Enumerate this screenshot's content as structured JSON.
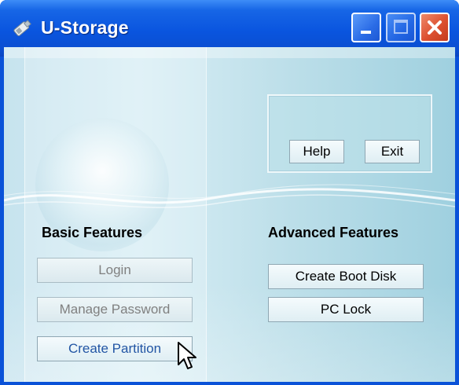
{
  "window": {
    "title": "U-Storage",
    "controls": {
      "minimize": "minimize",
      "maximize": "maximize",
      "close": "close"
    }
  },
  "basic": {
    "heading": "Basic Features",
    "buttons": [
      {
        "label": "Login",
        "state": "disabled"
      },
      {
        "label": "Manage Password",
        "state": "disabled"
      },
      {
        "label": "Create Partition",
        "state": "enabled"
      }
    ]
  },
  "advanced": {
    "heading": "Advanced Features",
    "buttons": [
      {
        "label": "Create Boot Disk"
      },
      {
        "label": "PC Lock"
      }
    ]
  },
  "utility": {
    "help_label": "Help",
    "exit_label": "Exit"
  },
  "icons": {
    "app_icon": "usb-drive-icon",
    "cursor": "mouse-pointer-icon"
  },
  "colors": {
    "titlebar": "#0a55df",
    "client_background": "#c6e3ee",
    "close_button": "#dc5030",
    "link_text": "#2255a4"
  }
}
